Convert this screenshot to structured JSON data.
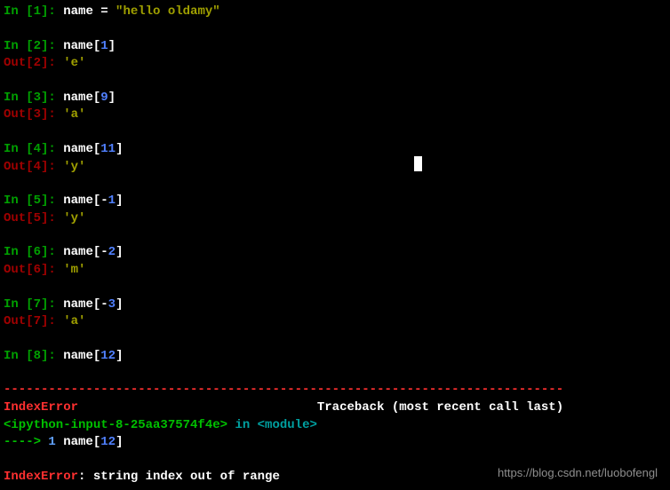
{
  "cells": [
    {
      "in_n": "1",
      "code_pre": "name = ",
      "str": "\"hello oldamy\"",
      "has_out": false
    },
    {
      "in_n": "2",
      "code_pre": "name[",
      "idx": "1",
      "code_post": "]",
      "has_out": true,
      "out_n": "2",
      "out_val": "'e'"
    },
    {
      "in_n": "3",
      "code_pre": "name[",
      "idx": "9",
      "code_post": "]",
      "has_out": true,
      "out_n": "3",
      "out_val": "'a'"
    },
    {
      "in_n": "4",
      "code_pre": "name[",
      "idx": "11",
      "code_post": "]",
      "has_out": true,
      "out_n": "4",
      "out_val": "'y'"
    },
    {
      "in_n": "5",
      "code_pre": "name[-",
      "idx": "1",
      "code_post": "]",
      "has_out": true,
      "out_n": "5",
      "out_val": "'y'"
    },
    {
      "in_n": "6",
      "code_pre": "name[-",
      "idx": "2",
      "code_post": "]",
      "has_out": true,
      "out_n": "6",
      "out_val": "'m'"
    },
    {
      "in_n": "7",
      "code_pre": "name[-",
      "idx": "3",
      "code_post": "]",
      "has_out": true,
      "out_n": "7",
      "out_val": "'a'"
    },
    {
      "in_n": "8",
      "code_pre": "name[",
      "idx": "12",
      "code_post": "]",
      "has_out": false
    }
  ],
  "sep": "---------------------------------------------------------------------------",
  "error": {
    "name1": "IndexError",
    "gap1": "                                ",
    "tb": "Traceback (most recent call last)",
    "ipy": "<ipython-input-8-25aa37574f4e>",
    "in_word": " in ",
    "module": "<module>",
    "arrow": "----> ",
    "lineno": "1",
    "expr_pre": " name[",
    "expr_idx": "12",
    "expr_post": "]",
    "name2": "IndexError",
    "colon_msg": ": string index out of range"
  },
  "watermark": "https://blog.csdn.net/luobofengl"
}
